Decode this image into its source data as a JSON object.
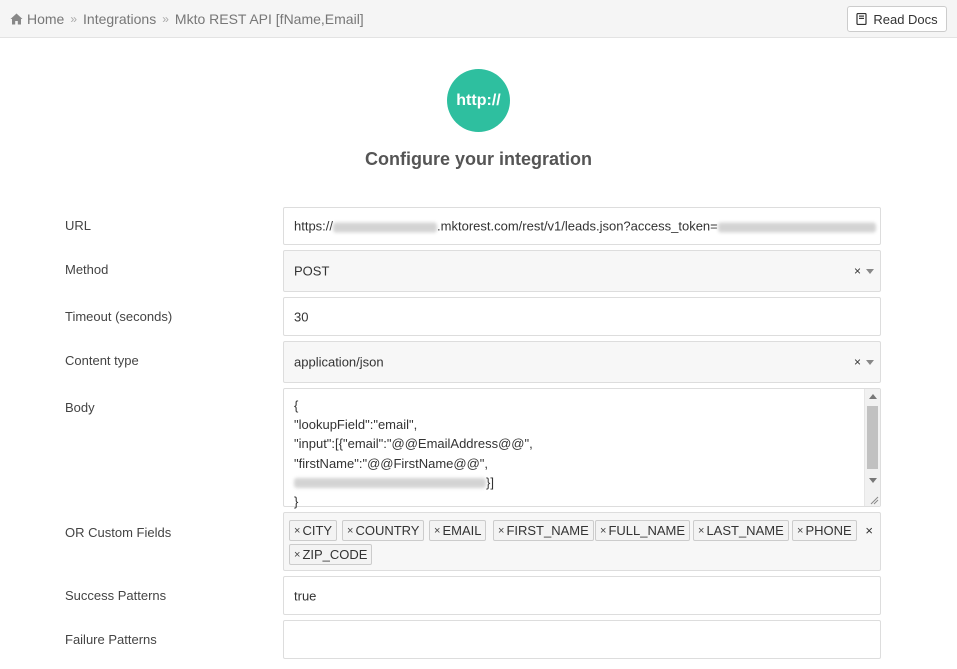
{
  "breadcrumb": {
    "home": "Home",
    "separator": "»",
    "integrations": "Integrations",
    "current": "Mkto REST API [fName,Email]"
  },
  "header": {
    "read_docs_label": "Read Docs"
  },
  "logo": {
    "text": "http://",
    "color": "#2ebf9f"
  },
  "title": "Configure your integration",
  "form": {
    "url": {
      "label": "URL",
      "value_prefix": "https://",
      "value_middle": ".mktorest.com/rest/v1/leads.json?access_token="
    },
    "method": {
      "label": "Method",
      "value": "POST",
      "clear": "×"
    },
    "timeout": {
      "label": "Timeout (seconds)",
      "value": "30"
    },
    "content_type": {
      "label": "Content type",
      "value": "application/json",
      "clear": "×"
    },
    "body": {
      "label": "Body",
      "lines": [
        "{",
        "\"lookupField\":\"email\",",
        "\"input\":[{\"email\":\"@@EmailAddress@@\",",
        "\"firstName\":\"@@FirstName@@\",",
        "}]",
        "}"
      ]
    },
    "custom_fields": {
      "label": "OR Custom Fields",
      "tag_remove": "×",
      "tags": [
        "CITY",
        "COUNTRY",
        "EMAIL",
        "FIRST_NAME",
        "FULL_NAME",
        "LAST_NAME",
        "PHONE",
        "ZIP_CODE"
      ],
      "clear": "×"
    },
    "success_patterns": {
      "label": "Success Patterns",
      "value": "true"
    },
    "failure_patterns": {
      "label": "Failure Patterns",
      "value": ""
    }
  }
}
